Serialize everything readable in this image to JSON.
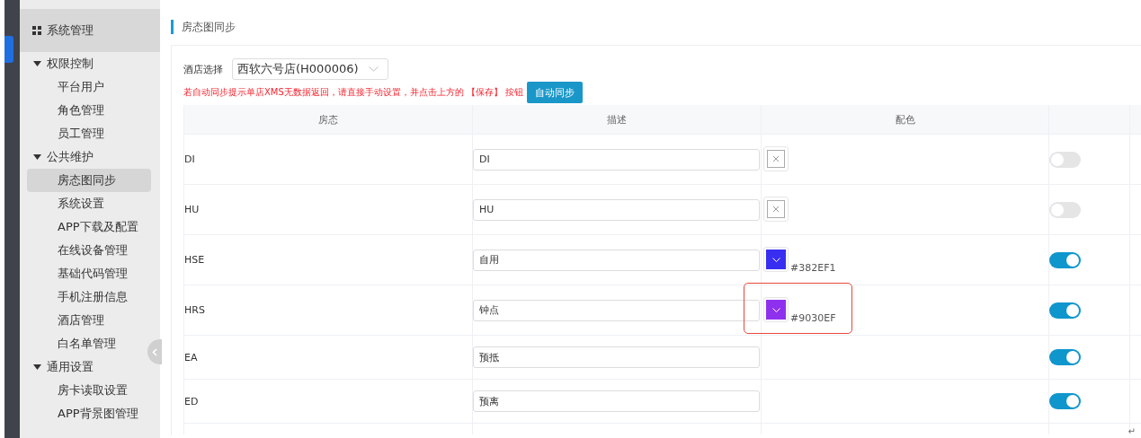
{
  "sidebar": {
    "header": "系统管理",
    "groups": [
      {
        "label": "权限控制",
        "expanded": true,
        "items": [
          {
            "label": "平台用户",
            "selected": false
          },
          {
            "label": "角色管理",
            "selected": false
          },
          {
            "label": "员工管理",
            "selected": false
          }
        ]
      },
      {
        "label": "公共维护",
        "expanded": true,
        "items": [
          {
            "label": "房态图同步",
            "selected": true
          },
          {
            "label": "系统设置",
            "selected": false
          },
          {
            "label": "APP下载及配置",
            "selected": false
          },
          {
            "label": "在线设备管理",
            "selected": false
          },
          {
            "label": "基础代码管理",
            "selected": false
          },
          {
            "label": "手机注册信息",
            "selected": false
          },
          {
            "label": "酒店管理",
            "selected": false
          },
          {
            "label": "白名单管理",
            "selected": false
          }
        ]
      },
      {
        "label": "通用设置",
        "expanded": true,
        "items": [
          {
            "label": "房卡读取设置",
            "selected": false
          },
          {
            "label": "APP背景图管理",
            "selected": false
          }
        ]
      }
    ]
  },
  "page_title": "房态图同步",
  "hotel_select": {
    "label": "酒店选择",
    "value": "西软六号店(H000006)"
  },
  "warning": "若自动同步提示单店XMS无数据返回，请直接手动设置，并点击上方的 【保存】 按钮",
  "sync_button": "自动同步",
  "table": {
    "columns": [
      "房态",
      "描述",
      "配色"
    ],
    "rows": [
      {
        "status": "DI",
        "description": "DI",
        "kind": "none",
        "on": false,
        "highlighted": false
      },
      {
        "status": "HU",
        "description": "HU",
        "kind": "none",
        "on": false,
        "highlighted": false
      },
      {
        "status": "HSE",
        "description": "自用",
        "kind": "swatch",
        "color": "#382ef1",
        "hex": "#382EF1",
        "on": true,
        "highlighted": false
      },
      {
        "status": "HRS",
        "description": "钟点",
        "kind": "swatch",
        "color": "#9030ef",
        "hex": "#9030EF",
        "on": true,
        "highlighted": true
      },
      {
        "status": "EA",
        "description": "预抵",
        "kind": "empty",
        "on": true,
        "highlighted": false
      },
      {
        "status": "ED",
        "description": "预离",
        "kind": "empty",
        "on": true,
        "highlighted": false
      }
    ]
  },
  "return_mark": "↵"
}
